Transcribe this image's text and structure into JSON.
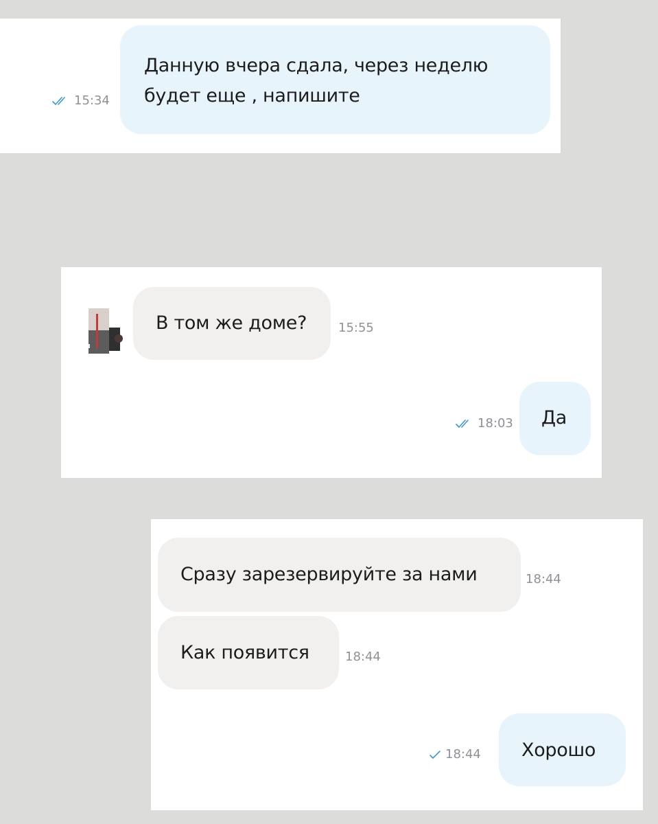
{
  "colors": {
    "outgoing_bubble": "#e8f4fc",
    "incoming_bubble": "#f1f0ee",
    "check_mark": "#3d95d6",
    "time_text": "#8e9196",
    "page_background": "#dcdcdb"
  },
  "card1": {
    "messages": [
      {
        "direction": "outgoing",
        "line1": "Данную вчера сдала, через неделю",
        "line2": "будет еще , напишите",
        "time": "15:34",
        "status_icon": "double-check-icon"
      }
    ]
  },
  "card2": {
    "avatar_icon": "contact-avatar",
    "messages": [
      {
        "direction": "incoming",
        "text": "В том же доме?",
        "time": "15:55"
      },
      {
        "direction": "outgoing",
        "text": "Да",
        "time": "18:03",
        "status_icon": "double-check-icon"
      }
    ]
  },
  "card3": {
    "messages": [
      {
        "direction": "incoming",
        "text": "Сразу зарезервируйте за нами",
        "time": "18:44"
      },
      {
        "direction": "incoming",
        "text": "Как появится",
        "time": "18:44"
      },
      {
        "direction": "outgoing",
        "text": "Хорошо",
        "time": "18:44",
        "status_icon": "single-check-icon"
      }
    ]
  }
}
